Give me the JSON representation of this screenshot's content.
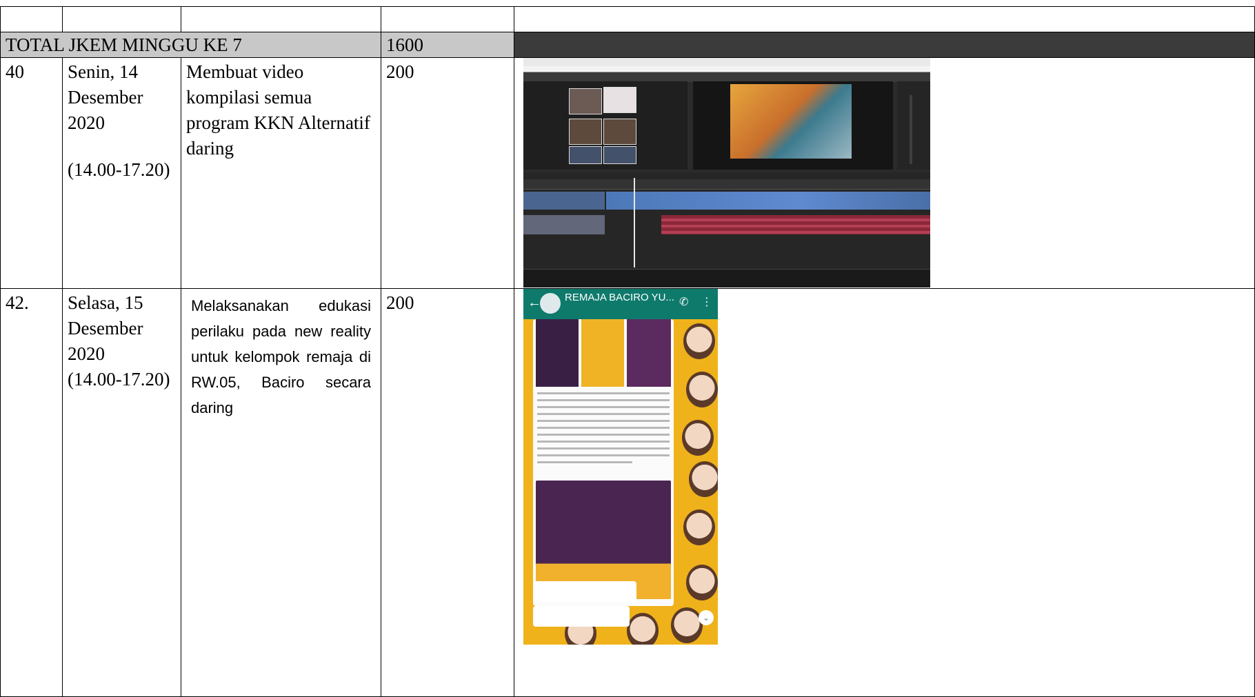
{
  "table": {
    "total_row": {
      "label": "TOTAL JKEM MINGGU KE 7",
      "value": "1600"
    },
    "rows": [
      {
        "no": "40",
        "date": "Senin, 14 Desember 2020",
        "time": "(14.00-17.20)",
        "activity": "Membuat video kompilasi semua program KKN Alternatif daring",
        "jkem": "200"
      },
      {
        "no": "42.",
        "date": "Selasa, 15 Desember 2020",
        "time": "(14.00-17.20)",
        "activity": "Melaksanakan edukasi perilaku pada new reality untuk kelompok remaja di RW.05, Baciro secara daring",
        "jkem": "200"
      }
    ]
  },
  "chat_screenshot": {
    "group_name": "REMAJA BACIRO YU...",
    "back_icon": "arrow-left-icon",
    "call_icon": "add-call-icon",
    "menu_icon": "kebab-menu-icon"
  },
  "colors": {
    "total_label_bg": "#c8c8c8",
    "total_right_bg": "#3b3b3b",
    "chat_header": "#0e7a6c",
    "chat_wallpaper": "#efb21a"
  }
}
